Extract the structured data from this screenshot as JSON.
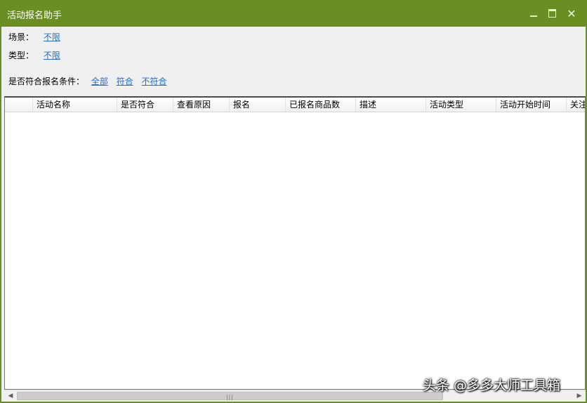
{
  "window": {
    "title": "活动报名助手"
  },
  "filters": {
    "scene": {
      "label": "场景：",
      "options": [
        "不限"
      ]
    },
    "type": {
      "label": "类型：",
      "options": [
        "不限"
      ]
    },
    "condition": {
      "label": "是否符合报名条件：",
      "options": [
        "全部",
        "符合",
        "不符合"
      ]
    }
  },
  "table": {
    "columns": [
      "",
      "活动名称",
      "是否符合",
      "查看原因",
      "报名",
      "已报名商品数",
      "描述",
      "活动类型",
      "活动开始时间",
      "关注"
    ],
    "rows": []
  },
  "watermark": {
    "text": "头条 @多多大师工具箱"
  },
  "icons": [
    "minimize-icon",
    "maximize-icon",
    "close-icon",
    "scroll-left-icon",
    "scroll-right-icon"
  ],
  "colors": {
    "titlebar": "#6b8e23",
    "link": "#1f6fd2"
  }
}
